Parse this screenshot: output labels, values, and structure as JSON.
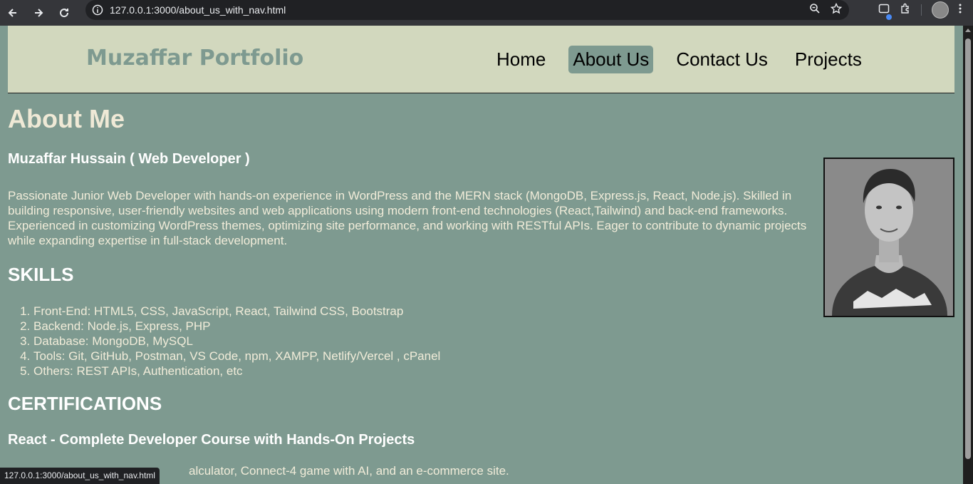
{
  "browser": {
    "url": "127.0.0.1:3000/about_us_with_nav.html",
    "status_url": "127.0.0.1:3000/about_us_with_nav.html"
  },
  "site": {
    "logo": "Muzaffar Portfolio",
    "nav": [
      {
        "label": "Home",
        "active": false
      },
      {
        "label": "About Us",
        "active": true
      },
      {
        "label": "Contact Us",
        "active": false
      },
      {
        "label": "Projects",
        "active": false
      }
    ]
  },
  "about": {
    "title": "About Me",
    "name": "Muzaffar Hussain ( Web Developer )",
    "bio": "Passionate Junior Web Developer with hands-on experience in WordPress and the MERN stack (MongoDB, Express.js, React, Node.js). Skilled in building responsive, user-friendly websites and web applications using modern front-end technologies (React,Tailwind) and back-end frameworks. Experienced in customizing WordPress themes, optimizing site performance, and working with RESTful APIs. Eager to contribute to dynamic projects while expanding expertise in full-stack development.",
    "skills_title": "SKILLS",
    "skills": [
      "Front-End: HTML5, CSS, JavaScript, React, Tailwind CSS, Bootstrap",
      "Backend: Node.js, Express, PHP",
      "Database: MongoDB, MySQL",
      "Tools: Git, GitHub, Postman, VS Code, npm, XAMPP, Netlify/Vercel , cPanel",
      "Others: REST APIs, Authentication, etc"
    ],
    "cert_title": "CERTIFICATIONS",
    "course_title": "React - Complete Developer Course with Hands-On Projects",
    "course_line_visible": "alculator, Connect-4 game with AI, and an e-commerce site."
  },
  "colors": {
    "page_bg": "#7e9a90",
    "nav_bg": "#d2d8be",
    "active_nav": "#7e9a90"
  }
}
